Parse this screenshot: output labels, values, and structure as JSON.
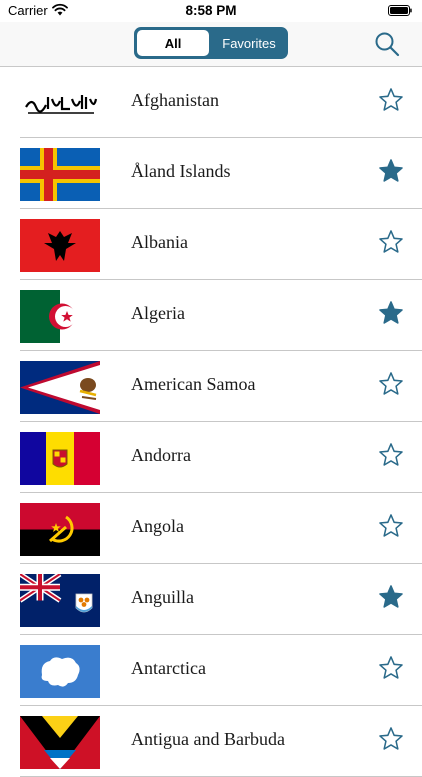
{
  "status_bar": {
    "carrier": "Carrier",
    "time": "8:58 PM"
  },
  "nav": {
    "segments": [
      {
        "label": "All",
        "selected": true
      },
      {
        "label": "Favorites",
        "selected": false
      }
    ],
    "search_icon": "search-icon"
  },
  "colors": {
    "accent": "#2a6a8a"
  },
  "countries": [
    {
      "name": "Afghanistan",
      "favorite": false
    },
    {
      "name": "Åland Islands",
      "favorite": true
    },
    {
      "name": "Albania",
      "favorite": false
    },
    {
      "name": "Algeria",
      "favorite": true
    },
    {
      "name": "American Samoa",
      "favorite": false
    },
    {
      "name": "Andorra",
      "favorite": false
    },
    {
      "name": "Angola",
      "favorite": false
    },
    {
      "name": "Anguilla",
      "favorite": true
    },
    {
      "name": "Antarctica",
      "favorite": false
    },
    {
      "name": "Antigua and Barbuda",
      "favorite": false
    }
  ]
}
